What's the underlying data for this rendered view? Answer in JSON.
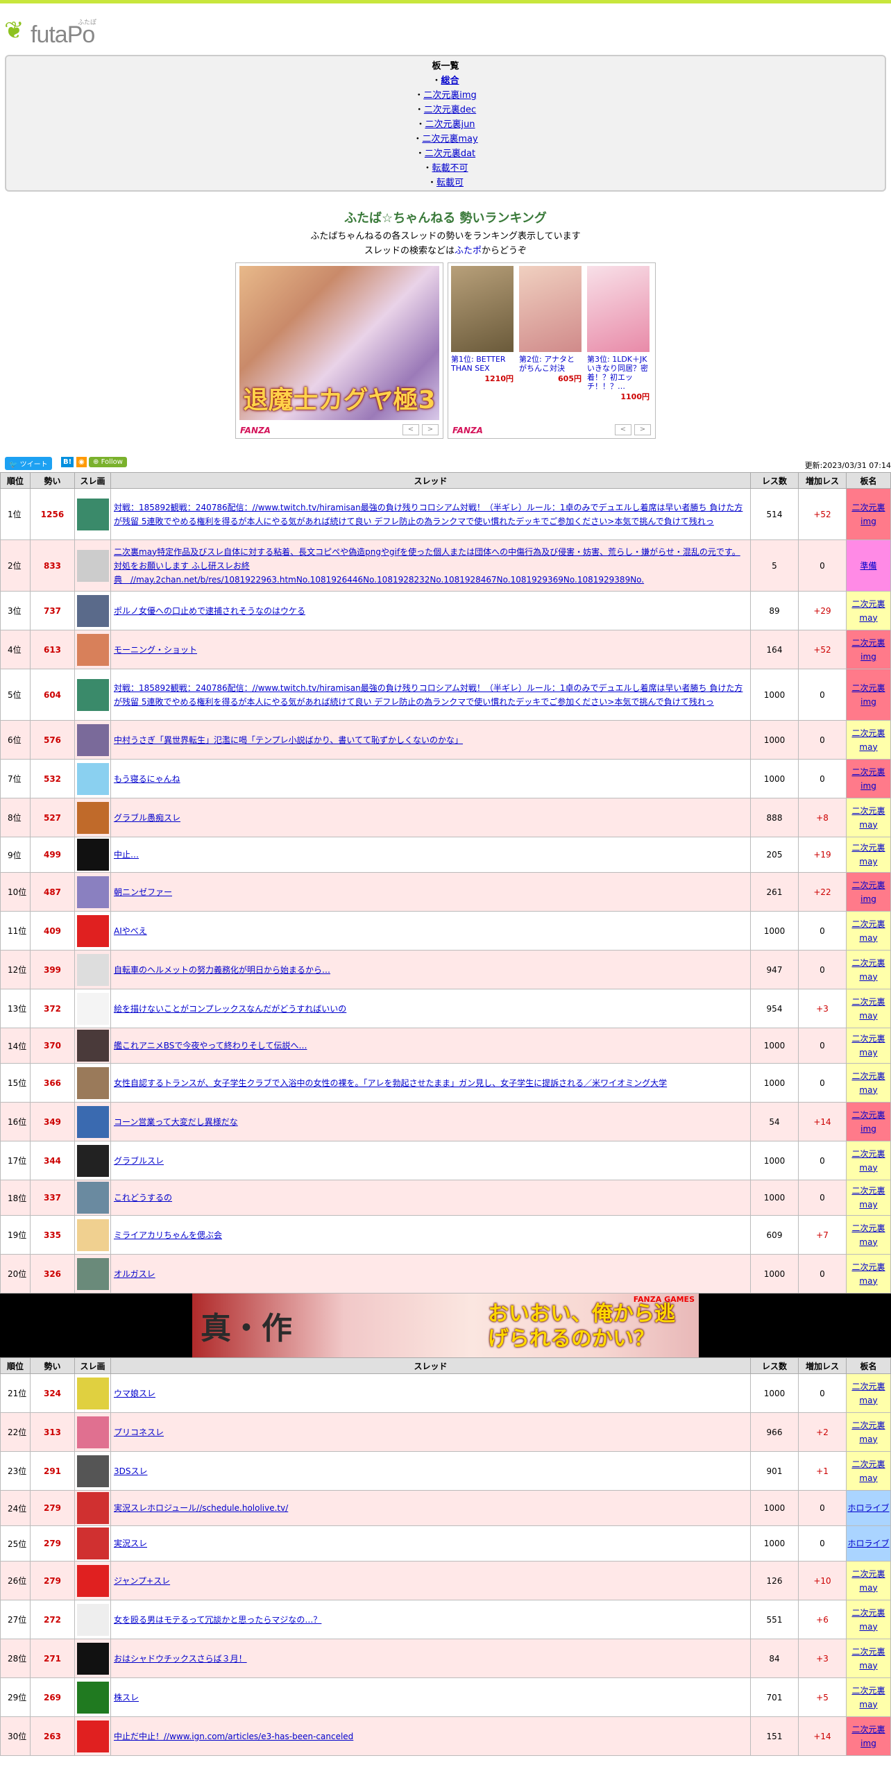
{
  "header": {
    "logo_text": "futaPo",
    "logo_kana": "ふたぽ"
  },
  "boards": {
    "title": "板一覧",
    "items": [
      "総合",
      "二次元裏img",
      "二次元裏dec",
      "二次元裏jun",
      "二次元裏may",
      "二次元裏dat",
      "転載不可",
      "転載可"
    ]
  },
  "ranking": {
    "title": "ふたば☆ちゃんねる 勢いランキング",
    "desc1": "ふたばちゃんねるの各スレッドの勢いをランキング表示しています",
    "desc2_pre": "スレッドの検索などは",
    "desc2_link": "ふたポ",
    "desc2_post": "からどうぞ"
  },
  "ad_left": {
    "title": "退魔士カグヤ極3",
    "brand": "FANZA"
  },
  "ad_right": {
    "brand": "FANZA",
    "items": [
      {
        "label": "第1位: BETTER THAN SEX",
        "price": "1210円"
      },
      {
        "label": "第2位: アナタとがちんこ対決",
        "price": "605円"
      },
      {
        "label": "第3位: 1LDK＋JKいきなり同居？密着！？初エッチ！！？…",
        "price": "1100円"
      }
    ]
  },
  "share": {
    "tweet": "ツイート",
    "hatena": "B!",
    "rss": "RSS",
    "follow": "Follow",
    "updated": "更新:2023/03/31 07:14"
  },
  "table_headers": {
    "rank": "順位",
    "momentum": "勢い",
    "thumb": "スレ画",
    "thread": "スレッド",
    "res": "レス数",
    "inc": "増加レス",
    "board": "板名"
  },
  "banner": {
    "title": "真・作",
    "catch": "おいおい、俺から逃げられるのかい？",
    "brand": "FANZA GAMES"
  },
  "rows1": [
    {
      "rank": "1位",
      "mom": "1256",
      "title": "対戦：185892観戦：240786配信：//www.twitch.tv/hiramisan最強の負け残りコロシアム対戦！（半ギレ）ルール：1卓のみでデュエルし着席は早い者勝ち 負けた方が残留 5連敗でやめる権利を得るが本人にやる気があれば続けて良い デフレ防止の為ランクマで使い慣れたデッキでご参加ください>本気で挑んで負けて残れっ",
      "res": "514",
      "inc": "+52",
      "board": "二次元裏img",
      "btype": "img",
      "thumb": "#3a8a6a"
    },
    {
      "rank": "2位",
      "mom": "833",
      "title": "二次裏may特定作品及びスレ自体に対する粘着、長文コピペや偽造pngやgifを使った個人または団体への中傷行為及び侵害・妨害、荒らし・嫌がらせ・混乱の元です。対処をお願いします ふし研スレお終典　//may.2chan.net/b/res/1081922963.htmNo.1081926446No.1081928232No.1081928467No.1081929369No.1081929389No.",
      "res": "5",
      "inc": "0",
      "board": "準備",
      "btype": "jun",
      "thumb": "#cccccc"
    },
    {
      "rank": "3位",
      "mom": "737",
      "title": "ポルノ女優への口止めで逮捕されそうなのはウケる",
      "res": "89",
      "inc": "+29",
      "board": "二次元裏may",
      "btype": "may",
      "thumb": "#5a6a8a"
    },
    {
      "rank": "4位",
      "mom": "613",
      "title": "モーニング・ショット",
      "res": "164",
      "inc": "+52",
      "board": "二次元裏img",
      "btype": "img",
      "thumb": "#d8805a"
    },
    {
      "rank": "5位",
      "mom": "604",
      "title": "対戦：185892観戦：240786配信：//www.twitch.tv/hiramisan最強の負け残りコロシアム対戦！（半ギレ）ルール：1卓のみでデュエルし着席は早い者勝ち 負けた方が残留 5連敗でやめる権利を得るが本人にやる気があれば続けて良い デフレ防止の為ランクマで使い慣れたデッキでご参加ください>本気で挑んで負けて残れっ",
      "res": "1000",
      "inc": "0",
      "board": "二次元裏img",
      "btype": "img",
      "thumb": "#3a8a6a"
    },
    {
      "rank": "6位",
      "mom": "576",
      "title": "中村うさぎ「異世界転生」氾濫に喝「テンプレ小説ばかり、書いてて恥ずかしくないのかな」",
      "res": "1000",
      "inc": "0",
      "board": "二次元裏may",
      "btype": "may",
      "thumb": "#7a6a9a"
    },
    {
      "rank": "7位",
      "mom": "532",
      "title": "もう寝るにゃんね",
      "res": "1000",
      "inc": "0",
      "board": "二次元裏img",
      "btype": "img",
      "thumb": "#8ad0f0"
    },
    {
      "rank": "8位",
      "mom": "527",
      "title": "グラブル愚痴スレ",
      "res": "888",
      "inc": "+8",
      "board": "二次元裏may",
      "btype": "may",
      "thumb": "#c06a2a"
    },
    {
      "rank": "9位",
      "mom": "499",
      "title": "中止…",
      "res": "205",
      "inc": "+19",
      "board": "二次元裏may",
      "btype": "may",
      "thumb": "#111111"
    },
    {
      "rank": "10位",
      "mom": "487",
      "title": "朝ニンゼファー",
      "res": "261",
      "inc": "+22",
      "board": "二次元裏img",
      "btype": "img",
      "thumb": "#8a80c0"
    },
    {
      "rank": "11位",
      "mom": "409",
      "title": "AIやべえ",
      "res": "1000",
      "inc": "0",
      "board": "二次元裏may",
      "btype": "may",
      "thumb": "#e02020"
    },
    {
      "rank": "12位",
      "mom": "399",
      "title": "自転車のヘルメットの努力義務化が明日から始まるから…",
      "res": "947",
      "inc": "0",
      "board": "二次元裏may",
      "btype": "may",
      "thumb": "#dddddd"
    },
    {
      "rank": "13位",
      "mom": "372",
      "title": "絵を描けないことがコンプレックスなんだがどうすればいいの",
      "res": "954",
      "inc": "+3",
      "board": "二次元裏may",
      "btype": "may",
      "thumb": "#f4f4f4"
    },
    {
      "rank": "14位",
      "mom": "370",
      "title": "艦これアニメBSで今夜やって終わりそして伝説へ…",
      "res": "1000",
      "inc": "0",
      "board": "二次元裏may",
      "btype": "may",
      "thumb": "#4a3a3a"
    },
    {
      "rank": "15位",
      "mom": "366",
      "title": "女性自認するトランスが、女子学生クラブで入浴中の女性の裸を。「アレを勃起させたまま」ガン見し、女子学生に提訴される／米ワイオミング大学",
      "res": "1000",
      "inc": "0",
      "board": "二次元裏may",
      "btype": "may",
      "thumb": "#9a7a5a"
    },
    {
      "rank": "16位",
      "mom": "349",
      "title": "コーン営業って大変だし異様だな",
      "res": "54",
      "inc": "+14",
      "board": "二次元裏img",
      "btype": "img",
      "thumb": "#3a6ab0"
    },
    {
      "rank": "17位",
      "mom": "344",
      "title": "グラブルスレ",
      "res": "1000",
      "inc": "0",
      "board": "二次元裏may",
      "btype": "may",
      "thumb": "#222222"
    },
    {
      "rank": "18位",
      "mom": "337",
      "title": "これどうするの",
      "res": "1000",
      "inc": "0",
      "board": "二次元裏may",
      "btype": "may",
      "thumb": "#6a8aa0"
    },
    {
      "rank": "19位",
      "mom": "335",
      "title": "ミライアカリちゃんを偲ぶ会",
      "res": "609",
      "inc": "+7",
      "board": "二次元裏may",
      "btype": "may",
      "thumb": "#f0d090"
    },
    {
      "rank": "20位",
      "mom": "326",
      "title": "オルガスレ",
      "res": "1000",
      "inc": "0",
      "board": "二次元裏may",
      "btype": "may",
      "thumb": "#6a8a7a"
    }
  ],
  "rows2": [
    {
      "rank": "21位",
      "mom": "324",
      "title": "ウマ娘スレ",
      "res": "1000",
      "inc": "0",
      "board": "二次元裏may",
      "btype": "may",
      "thumb": "#e0d040"
    },
    {
      "rank": "22位",
      "mom": "313",
      "title": "プリコネスレ",
      "res": "966",
      "inc": "+2",
      "board": "二次元裏may",
      "btype": "may",
      "thumb": "#e07090"
    },
    {
      "rank": "23位",
      "mom": "291",
      "title": "3DSスレ",
      "res": "901",
      "inc": "+1",
      "board": "二次元裏may",
      "btype": "may",
      "thumb": "#555555"
    },
    {
      "rank": "24位",
      "mom": "279",
      "title": "実況スレホロジュール//schedule.hololive.tv/",
      "res": "1000",
      "inc": "0",
      "board": "ホロライブ",
      "btype": "holo",
      "thumb": "#d03030"
    },
    {
      "rank": "25位",
      "mom": "279",
      "title": "実況スレ",
      "res": "1000",
      "inc": "0",
      "board": "ホロライブ",
      "btype": "holo",
      "thumb": "#d03030"
    },
    {
      "rank": "26位",
      "mom": "279",
      "title": "ジャンプ+スレ",
      "res": "126",
      "inc": "+10",
      "board": "二次元裏may",
      "btype": "may",
      "thumb": "#e02020"
    },
    {
      "rank": "27位",
      "mom": "272",
      "title": "女を殴る男はモテるって冗談かと思ったらマジなの…？",
      "res": "551",
      "inc": "+6",
      "board": "二次元裏may",
      "btype": "may",
      "thumb": "#eeeeee"
    },
    {
      "rank": "28位",
      "mom": "271",
      "title": "おはシャドウチックスさらば３月！",
      "res": "84",
      "inc": "+3",
      "board": "二次元裏may",
      "btype": "may",
      "thumb": "#111111"
    },
    {
      "rank": "29位",
      "mom": "269",
      "title": "株スレ",
      "res": "701",
      "inc": "+5",
      "board": "二次元裏may",
      "btype": "may",
      "thumb": "#207a20"
    },
    {
      "rank": "30位",
      "mom": "263",
      "title": "中止だ中止！//www.ign.com/articles/e3-has-been-canceled",
      "res": "151",
      "inc": "+14",
      "board": "二次元裏img",
      "btype": "img",
      "thumb": "#e02020"
    }
  ]
}
